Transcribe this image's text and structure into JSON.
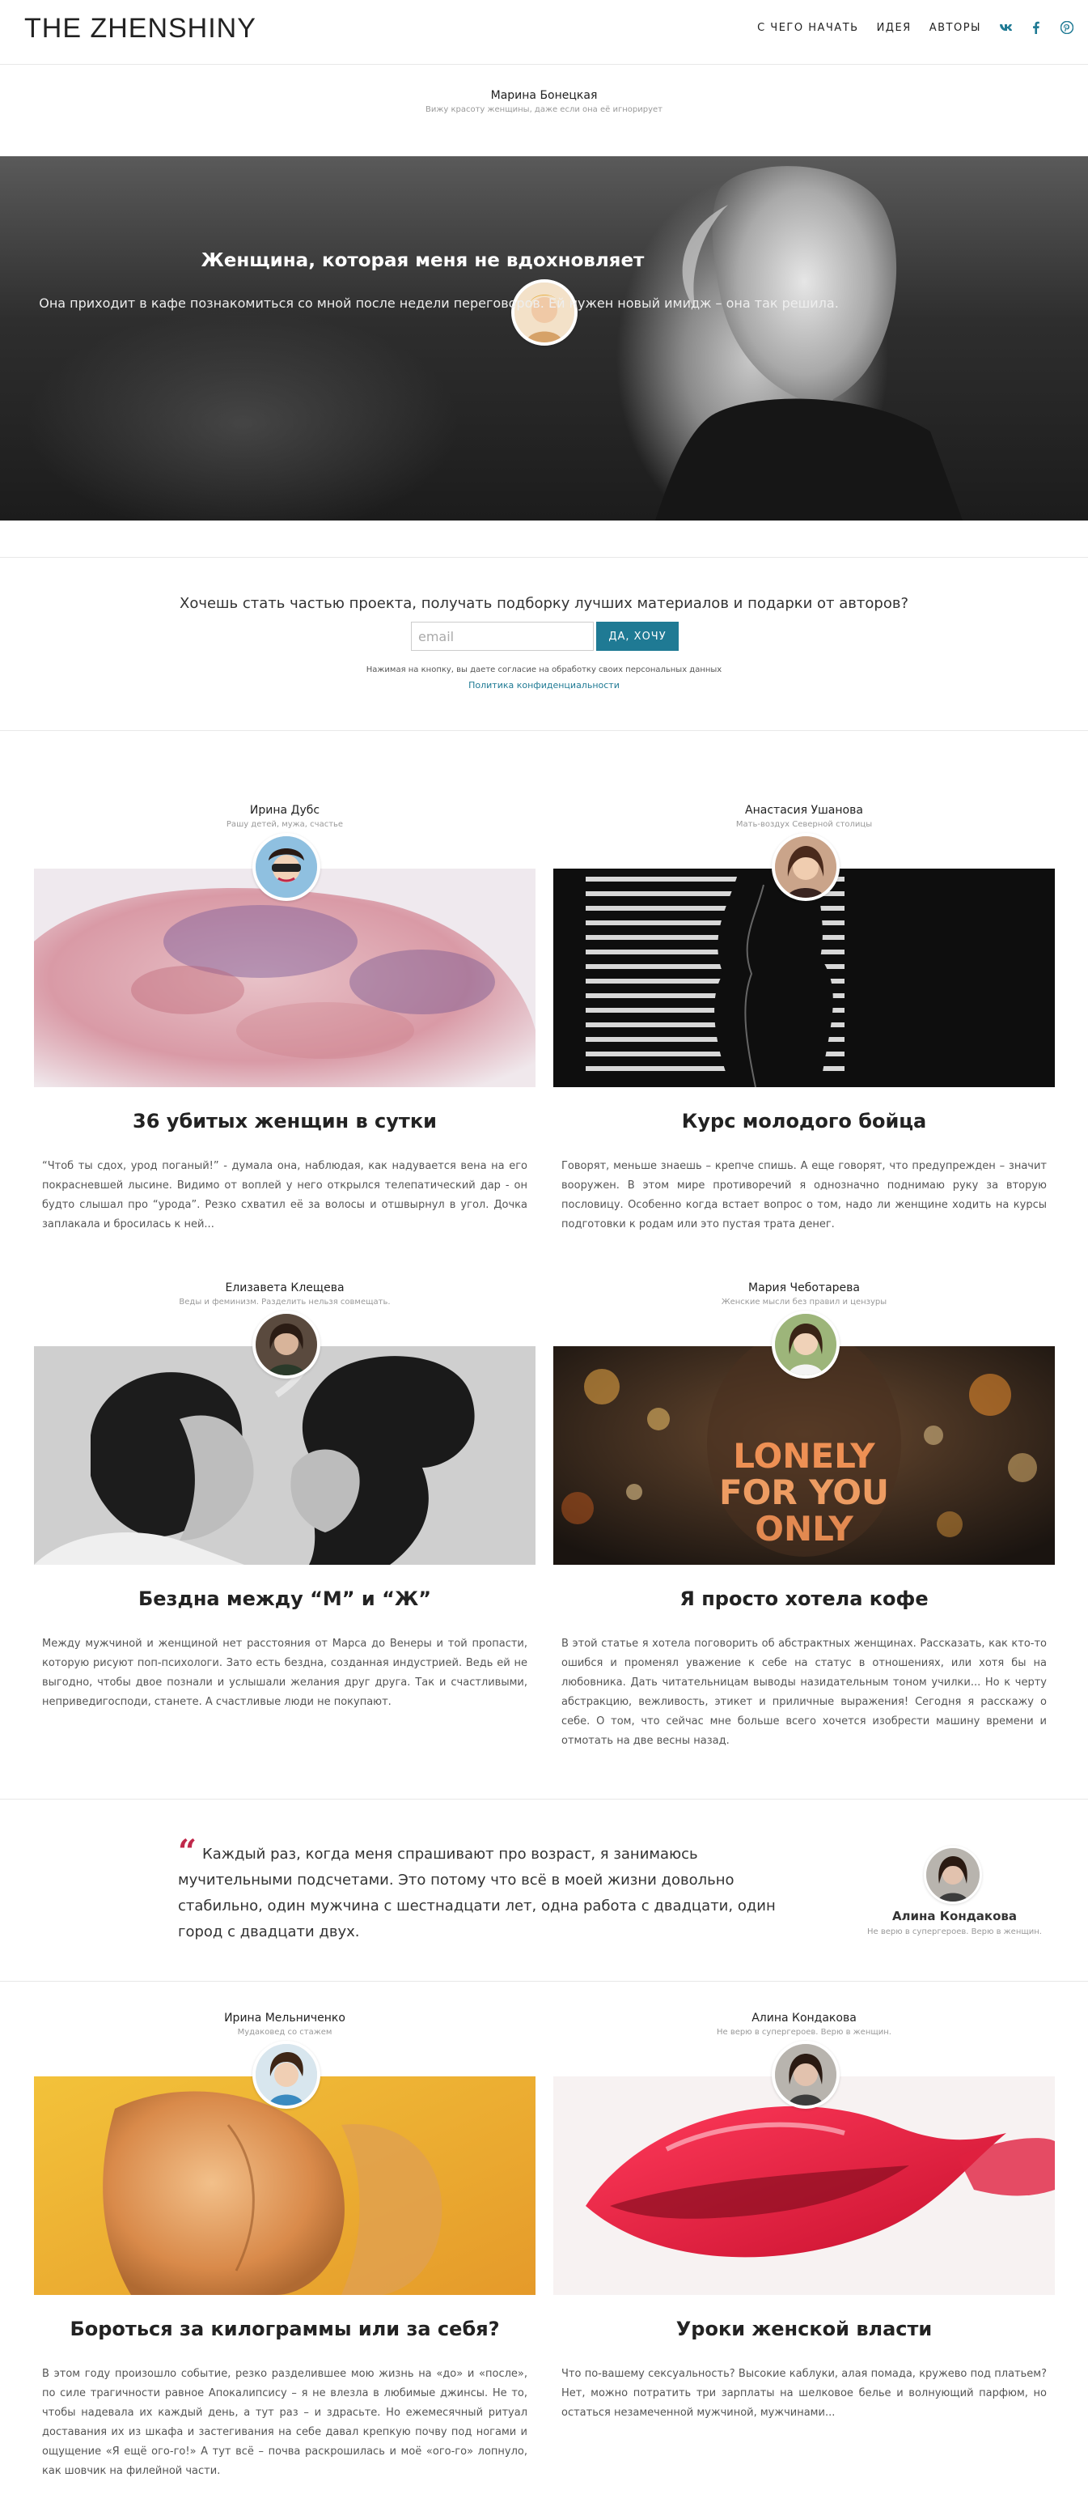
{
  "header": {
    "logo": "THE ZHENSHINY",
    "nav": [
      "С ЧЕГО НАЧАТЬ",
      "ИДЕЯ",
      "АВТОРЫ"
    ],
    "social": [
      "vk-icon",
      "facebook-icon",
      "pinterest-icon"
    ],
    "accent_color": "#1f7a94"
  },
  "hero": {
    "author_name": "Марина Бонецкая",
    "author_tagline": "Вижу красоту женщины, даже если она её игнорирует",
    "title": "Женщина, которая меня не вдохновляет",
    "subtitle": "Она приходит в кафе познакомиться со мной после недели переговоров. Ей нужен новый имидж – она так решила."
  },
  "subscribe": {
    "question": "Хочешь стать частью проекта, получать подборку лучших материалов и подарки от авторов?",
    "email_placeholder": "email",
    "button_label": "ДА, ХОЧУ",
    "consent": "Нажимая на кнопку, вы даете согласие на обработку своих персональных данных",
    "privacy_link": "Политика конфиденциальности"
  },
  "articles": [
    {
      "author": "Ирина Дубс",
      "tagline": "Рашу детей, мужа, счастье",
      "title": "36 убитых женщин в сутки",
      "excerpt": "“Чтоб ты сдох, урод поганый!” - думала она, наблюдая, как надувается вена на его покрасневшей лысине. Видимо от воплей у него открылся телепатический дар - он будто слышал про “урода”. Резко схватил её за волосы и отшвырнул в угол. Дочка заплакала и бросилась к ней..."
    },
    {
      "author": "Анастасия Ушанова",
      "tagline": "Мать-воздух Северной столицы",
      "title": "Курс молодого бойца",
      "excerpt": "Говорят, меньше знаешь – крепче спишь. А еще говорят, что предупрежден – значит вооружен. В этом мире противоречий я однозначно поднимаю руку за вторую пословицу. Особенно когда встает вопрос о том, надо ли женщине ходить на курсы подготовки к родам или это пустая трата денег."
    },
    {
      "author": "Елизавета Клещева",
      "tagline": "Веды и феминизм. Разделить нельзя совмещать.",
      "title": "Бездна между “М” и “Ж”",
      "excerpt": "Между мужчиной и женщиной нет расстояния от Марса до Венеры и той пропасти, которую рисуют поп-психологи. Зато есть бездна, созданная индустрией. Ведь ей не выгодно, чтобы двое познали и услышали желания друг друга. Так и счастливыми, неприведигосподи, станете. А счастливые люди не покупают."
    },
    {
      "author": "Мария Чеботарева",
      "tagline": "Женские мысли без правил и цензуры",
      "title": "Я просто хотела кофе",
      "excerpt": "В этой статье я хотела поговорить об абстрактных женщинах. Рассказать, как кто-то ошибся и променял уважение к себе на статус в отношениях, или хотя бы на любовника. Дать читательницам выводы назидательным тоном училки... Но к черту абстракцию, вежливость, этикет и приличные выражения! Сегодня я расскажу о себе. О том, что сейчас мне больше всего хочется изобрести машину времени и отмотать на две весны назад."
    },
    {
      "author": "Ирина Мельниченко",
      "tagline": "Мудаковед со стажем",
      "title": "Бороться за килограммы или за себя?",
      "excerpt": "В этом году произошло событие, резко разделившее мою жизнь на «до» и «после», по силе трагичности равное Апокалипсису – я не влезла в любимые джинсы. Не то, чтобы надевала их каждый день, а тут раз – и здрасьте. Но ежемесячный ритуал доставания их из шкафа и застегивания на себе давал крепкую почву под ногами и ощущение «Я ещё ого-го!» А тут всё – почва раскрошилась и моё «ого-го» лопнуло, как шовчик на филейной части."
    },
    {
      "author": "Алина Кондакова",
      "tagline": "Не верю в супергероев. Верю в женщин.",
      "title": "Уроки женской власти",
      "excerpt": "Что по-вашему сексуальность? Высокие каблуки, алая помада, кружево под платьем? Нет, можно потратить три зарплаты на шелковое белье и волнующий парфюм, но остаться незамеченной мужчиной, мужчинами..."
    }
  ],
  "quote": {
    "text": "Каждый раз, когда меня спрашивают про возраст, я занимаюсь мучительными подсчетами. Это потому что всё в моей жизни довольно стабильно, один мужчина с шестнадцати лет, одна работа с двадцати, один город с двадцати двух.",
    "author": "Алина Кондакова",
    "tagline": "Не верю в супергероев. Верю в женщин.",
    "mark_color": "#c0284a"
  }
}
